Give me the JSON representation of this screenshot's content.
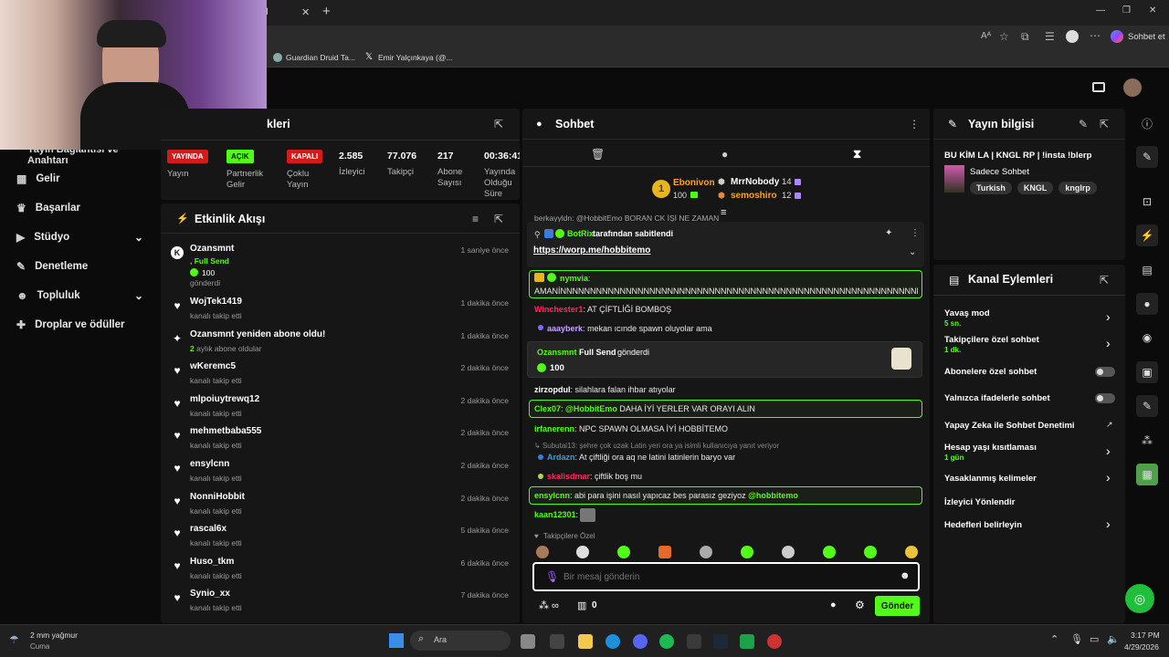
{
  "browser": {
    "tab_close": "✕",
    "tab_new": "+",
    "partial_tab": "d",
    "bookmarks": [
      "Guardian Druid Ta...",
      "Emir Yalçınkaya (@..."
    ],
    "chat_label": "Sohbet et",
    "window_controls": [
      "—",
      "❐",
      "✕"
    ]
  },
  "sidebar": {
    "partial_header": "Yayın Bağlantısı ve Anahtarı",
    "items": [
      {
        "label": "Gelir",
        "icon": "bank-icon"
      },
      {
        "label": "Başarılar",
        "icon": "trophy-icon"
      },
      {
        "label": "Stüdyo",
        "icon": "video-icon",
        "expand": true
      },
      {
        "label": "Denetleme",
        "icon": "wrench-icon"
      },
      {
        "label": "Topluluk",
        "icon": "users-icon",
        "expand": true
      },
      {
        "label": "Droplar ve ödüller",
        "icon": "gift-icon"
      }
    ]
  },
  "stats": {
    "title_partial": "kleri",
    "badges": [
      {
        "badge": "YAYINDA",
        "label": "Yayın",
        "color": "#d31b1b"
      },
      {
        "badge": "AÇIK",
        "label": "Partnerlik Gelir",
        "color": "#53fc18"
      },
      {
        "badge": "KAPALI",
        "label": "Çoklu Yayın",
        "color": "#d31b1b"
      }
    ],
    "numbers": [
      {
        "value": "2.585",
        "label": "İzleyici"
      },
      {
        "value": "77.076",
        "label": "Takipçi"
      },
      {
        "value": "217",
        "label": "Abone Sayısı"
      },
      {
        "value": "00:36:41",
        "label": "Yayında Olduğu Süre"
      }
    ]
  },
  "activity": {
    "title": "Etkinlik Akışı",
    "events": [
      {
        "name": "Ozansmnt",
        "sub": ", Full Send",
        "extra": "100",
        "extra2": "gönderdi",
        "time": "1 saniye önce",
        "icon": "kick-coin-icon"
      },
      {
        "name": "WojTek1419",
        "sub": "kanalı takip etti",
        "time": "1 dakika önce",
        "icon": "heart-icon"
      },
      {
        "name": "Ozansmnt yeniden abone oldu!",
        "sub_green": "2",
        "sub": " aylık abone oldular",
        "time": "1 dakika önce",
        "icon": "sparkle-icon"
      },
      {
        "name": "wKeremc5",
        "sub": "kanalı takip etti",
        "time": "2 dakika önce",
        "icon": "heart-icon"
      },
      {
        "name": "mlpoiuytrewq12",
        "sub": "kanalı takip etti",
        "time": "2 dakika önce",
        "icon": "heart-icon"
      },
      {
        "name": "mehmetbaba555",
        "sub": "kanalı takip etti",
        "time": "2 dakika önce",
        "icon": "heart-icon"
      },
      {
        "name": "ensylcnn",
        "sub": "kanalı takip etti",
        "time": "2 dakika önce",
        "icon": "heart-icon"
      },
      {
        "name": "NonniHobbit",
        "sub": "kanalı takip etti",
        "time": "2 dakika önce",
        "icon": "heart-icon"
      },
      {
        "name": "rascal6x",
        "sub": "kanalı takip etti",
        "time": "5 dakika önce",
        "icon": "heart-icon"
      },
      {
        "name": "Huso_tkm",
        "sub": "kanalı takip etti",
        "time": "6 dakika önce",
        "icon": "heart-icon"
      },
      {
        "name": "Synio_xx",
        "sub": "kanalı takip etti",
        "time": "7 dakika önce",
        "icon": "heart-icon"
      }
    ]
  },
  "chat": {
    "title": "Sohbet",
    "leaderboard": [
      {
        "name": "Ebonivon",
        "amount": "100",
        "rank": "1"
      },
      {
        "name": "MrrNobody",
        "amount": "14"
      },
      {
        "name": "semoshiro",
        "amount": "12"
      }
    ],
    "top_cut": "berkayyldn: @HobbitEmo BORAN CK İŞİ NE ZAMAN",
    "pinned_by": "BotRix",
    "pinned_label": "tarafından sabitlendi",
    "pinned_link": "https://worp.me/hobbitemo",
    "messages": [
      {
        "user": "nymvia",
        "text": "AMANİNNNNNNNNNNNNNNNNNNNNNNNNNNNNNNNNNNNNNNNNNNNNNNNNNNNNNNNNNNNNNNN"
      },
      {
        "user": "Winchester1",
        "text": "AT ÇİFTLİĞİ BOMBOŞ"
      },
      {
        "user": "aaayberk",
        "text": "mekan ıcınde spawn oluyolar ama"
      },
      {
        "user": "Ozansmnt",
        "text": "Full Send",
        "text2": "gönderdi",
        "amount": "100"
      },
      {
        "user": "zirzopdul",
        "text": "silahlara falan ihbar atıyolar"
      },
      {
        "user": "Clex07",
        "text": "@HobbitEmo DAHA İYİ YERLER VAR ORAYI ALIN"
      },
      {
        "user": "irfanerenn",
        "text": "NPC SPAWN OLMASA İYİ HOBBİTEMO"
      },
      {
        "reply": "Subutai13: şehre çok uzak Latin yeri ora ya isimli kullanıcıya yanıt veriyor"
      },
      {
        "user": "Ardazn",
        "text": "At çiftliği ora aq ne latini latinlerin baryo var"
      },
      {
        "user": "skalisdmar",
        "text": "çiftlik boş mu"
      },
      {
        "user": "ensylcnn",
        "text": "abi para işini nasıl yapıcaz bes parasız geziyoz",
        "mention": "@hobbitemo"
      },
      {
        "user": "kaan12301",
        "text": ""
      }
    ],
    "followers_only": "Takipçilere Özel",
    "input_placeholder": "Bir mesaj gönderin",
    "footer_count": "0",
    "send": "Gönder"
  },
  "stream_info": {
    "title": "Yayın bilgisi",
    "stream_title": "BU KİM LA | KNGL RP | !insta !blerp",
    "category": "Sadece Sohbet",
    "tags": [
      "Turkish",
      "KNGL",
      "knglrp"
    ]
  },
  "channel_actions": {
    "title": "Kanal Eylemleri",
    "items": [
      {
        "label": "Yavaş mod",
        "sub": "5 sn.",
        "type": "chevron"
      },
      {
        "label": "Takipçilere özel sohbet",
        "sub": "1 dk.",
        "type": "chevron"
      },
      {
        "label": "Abonelere özel sohbet",
        "type": "toggle"
      },
      {
        "label": "Yalnızca ifadelerle sohbet",
        "type": "toggle"
      },
      {
        "label": "Yapay Zeka ile Sohbet Denetimi",
        "type": "external"
      },
      {
        "label": "Hesap yaşı kısıtlaması",
        "sub": "1 gün",
        "type": "chevron"
      },
      {
        "label": "Yasaklanmış kelimeler",
        "type": "chevron"
      },
      {
        "label": "İzleyici Yönlendir",
        "type": "none"
      },
      {
        "label": "Hedefleri belirleyin",
        "type": "chevron"
      }
    ]
  },
  "taskbar": {
    "weather": "2 mm yağmur",
    "weather_sub": "Cuma",
    "search": "Ara",
    "time": "3:17 PM",
    "date": "4/29/2026"
  },
  "colors": {
    "accent": "#53fc18",
    "live": "#d31b1b",
    "panel": "#161616"
  }
}
